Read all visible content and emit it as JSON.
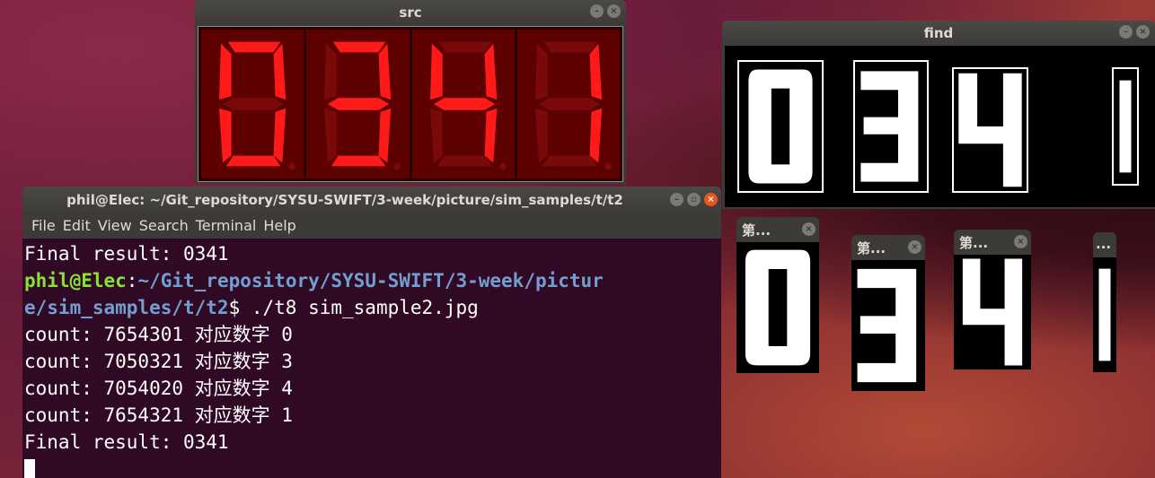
{
  "src_window": {
    "title": "src",
    "digits": [
      "0",
      "3",
      "4",
      "1"
    ]
  },
  "find_window": {
    "title": "find",
    "digits": [
      "0",
      "3",
      "4",
      "1"
    ]
  },
  "digit_windows": [
    {
      "title": "第..."
    },
    {
      "title": "第..."
    },
    {
      "title": "第..."
    },
    {
      "title": "..."
    }
  ],
  "terminal": {
    "title": "phil@Elec: ~/Git_repository/SYSU-SWIFT/3-week/picture/sim_samples/t/t2",
    "menu": [
      "File",
      "Edit",
      "View",
      "Search",
      "Terminal",
      "Help"
    ],
    "line1": "Final result: 0341",
    "prompt_user": "phil@Elec",
    "prompt_sep": ":",
    "prompt_path_1": "~/Git_repository/SYSU-SWIFT/3-week/pictur",
    "prompt_path_2": "e/sim_samples/t/t2",
    "prompt_cmd": "$ ./t8 sim_sample2.jpg",
    "counts": [
      "count: 7654301 对应数字 0",
      "count: 7050321 对应数字 3",
      "count: 7054020 对应数字 4",
      "count: 7654321 对应数字 1"
    ],
    "final": "Final result: 0341"
  },
  "colors": {
    "segment_on": "#ff1a1a",
    "segment_off": "#7a0a0a",
    "terminal_bg": "#300a24"
  }
}
